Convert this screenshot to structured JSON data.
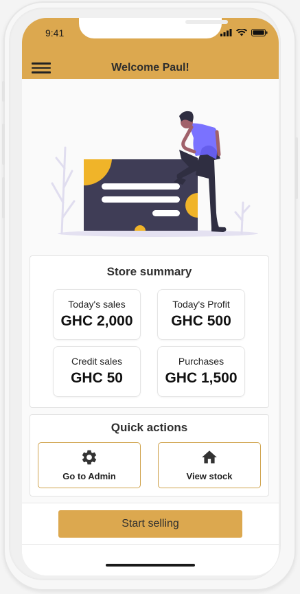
{
  "status_bar": {
    "time": "9:41"
  },
  "header": {
    "title": "Welcome Paul!"
  },
  "summary": {
    "title": "Store summary",
    "tiles": [
      {
        "label": "Today's sales",
        "value": "GHC 2,000"
      },
      {
        "label": "Today's Profit",
        "value": "GHC 500"
      },
      {
        "label": "Credit sales",
        "value": "GHC 50"
      },
      {
        "label": "Purchases",
        "value": "GHC 1,500"
      }
    ]
  },
  "quick_actions": {
    "title": "Quick actions",
    "buttons": [
      {
        "label": "Go to Admin",
        "icon": "gear-icon"
      },
      {
        "label": "View stock",
        "icon": "home-icon"
      }
    ]
  },
  "footer": {
    "cta_label": "Start selling"
  },
  "colors": {
    "accent": "#dca84f",
    "illustration_dark": "#3f3d56",
    "illustration_yellow": "#f0b429"
  }
}
